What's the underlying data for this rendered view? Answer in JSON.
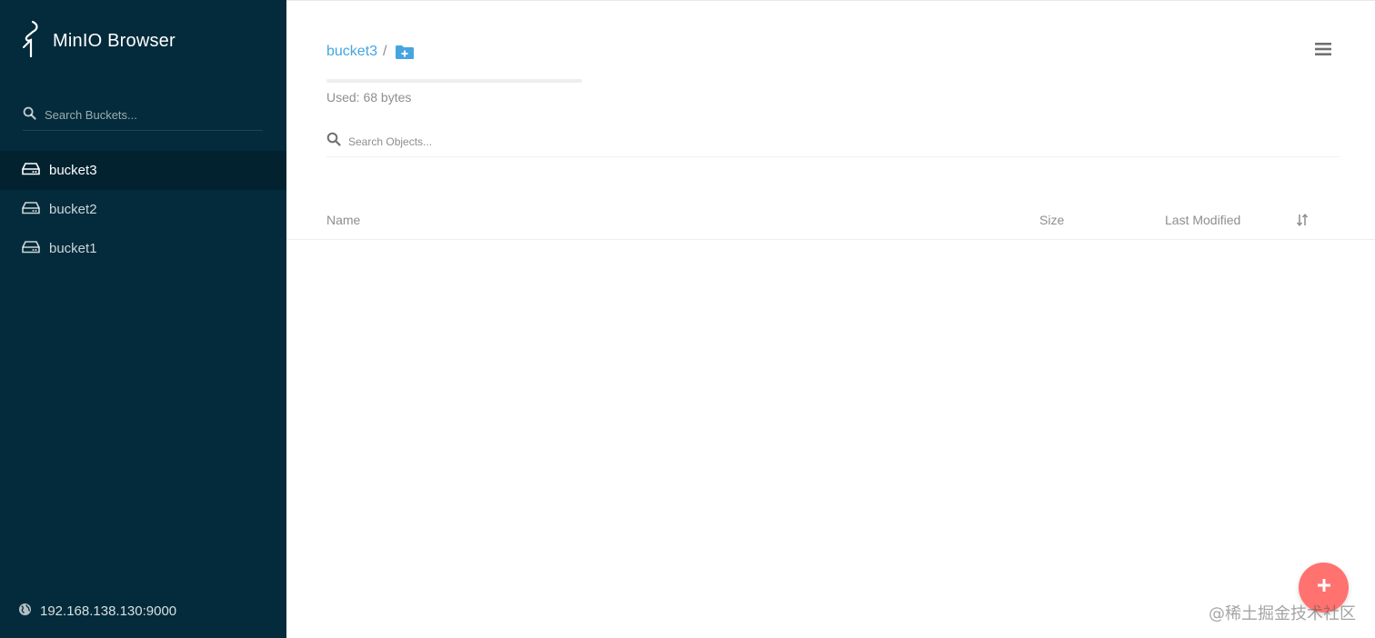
{
  "app": {
    "title": "MinIO Browser"
  },
  "sidebar": {
    "search_placeholder": "Search Buckets...",
    "buckets": [
      {
        "label": "bucket3",
        "active": true
      },
      {
        "label": "bucket2",
        "active": false
      },
      {
        "label": "bucket1",
        "active": false
      }
    ],
    "host": "192.168.138.130:9000",
    "background_color": "#032b3b"
  },
  "main": {
    "breadcrumb": {
      "bucket": "bucket3",
      "separator": "/"
    },
    "usage": {
      "text": "Used: 68 bytes",
      "fraction": 0.0
    },
    "object_search_placeholder": "Search Objects...",
    "columns": {
      "name": "Name",
      "size": "Size",
      "last_modified": "Last Modified"
    },
    "objects": []
  },
  "icons": {
    "logo": "minio-logo-icon",
    "search": "search-icon",
    "bucket": "hard-drive-icon",
    "globe": "globe-icon",
    "new_folder": "folder-plus-icon",
    "menu": "hamburger-menu-icon",
    "sort": "sort-icon",
    "fab": "plus-icon"
  },
  "colors": {
    "accent": "#46a5e0",
    "fab": "#ff726f"
  },
  "watermark": "@稀土掘金技术社区"
}
